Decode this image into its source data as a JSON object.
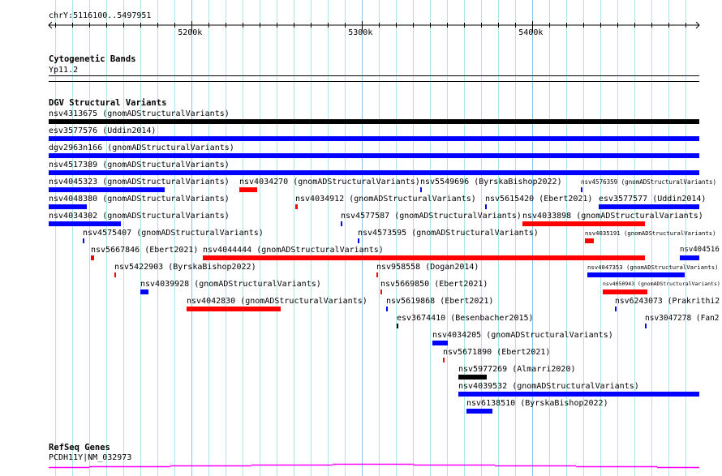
{
  "ruler": {
    "location": "chrY:5116100..5497951",
    "start": 5116100,
    "end": 5497951,
    "major_ticks": [
      "5200k",
      "5300k",
      "5400k"
    ],
    "major_values": [
      5200000,
      5300000,
      5400000
    ]
  },
  "cytoband": {
    "title": "Cytogenetic Bands",
    "band": "Yp11.2"
  },
  "dgv": {
    "title": "DGV Structural Variants",
    "colors": {
      "blue": "#0000ff",
      "red": "#ff0000",
      "black": "#000000"
    },
    "features": [
      {
        "row": 0,
        "label": "nsv4313675 (gnomADStructuralVariants)",
        "start": 5116100,
        "end": 5497951,
        "color": "black"
      },
      {
        "row": 1,
        "label": "esv3577576 (Uddin2014)",
        "start": 5116100,
        "end": 5497951,
        "color": "blue"
      },
      {
        "row": 2,
        "label": "dgv2963n166 (gnomADStructuralVariants)",
        "start": 5116100,
        "end": 5497951,
        "color": "blue"
      },
      {
        "row": 3,
        "label": "nsv4517389 (gnomADStructuralVariants)",
        "start": 5116100,
        "end": 5497951,
        "color": "blue"
      },
      {
        "row": 4,
        "label": "nsv4045323 (gnomADStructuralVariants)",
        "start": 5116100,
        "end": 5184195,
        "color": "blue"
      },
      {
        "row": 4,
        "label": "nsv4034270 (gnomADStructuralVariants)",
        "start": 5228005,
        "end": 5238481,
        "color": "red"
      },
      {
        "row": 4,
        "label": "nsv5549696 (ByrskaBishop2022)",
        "start": 5334195,
        "end": 5335147,
        "color": "blue"
      },
      {
        "row": 4,
        "label": "nsv4576359 (gnomADStructuralVariants)",
        "start": 5428481,
        "end": 5429433,
        "color": "blue"
      },
      {
        "row": 5,
        "label": "nsv4048380 (gnomADStructuralVariants)",
        "start": 5116100,
        "end": 5138481,
        "color": "blue"
      },
      {
        "row": 5,
        "label": "nsv4034912 (gnomADStructuralVariants)",
        "start": 5260862,
        "end": 5262290,
        "color": "red"
      },
      {
        "row": 5,
        "label": "nsv5615420 (Ebert2021)",
        "start": 5372290,
        "end": 5373243,
        "color": "blue"
      },
      {
        "row": 5,
        "label": "esv3577577 (Uddin2014)",
        "start": 5438957,
        "end": 5497951,
        "color": "blue"
      },
      {
        "row": 6,
        "label": "nsv4034302 (gnomADStructuralVariants)",
        "start": 5116100,
        "end": 5158481,
        "color": "blue"
      },
      {
        "row": 6,
        "label": "nsv4577587 (gnomADStructuralVariants)",
        "start": 5287529,
        "end": 5288481,
        "color": "blue"
      },
      {
        "row": 6,
        "label": "nsv4033898 (gnomADStructuralVariants)",
        "start": 5394195,
        "end": 5466100,
        "color": "red"
      },
      {
        "row": 7,
        "label": "nsv4575407 (gnomADStructuralVariants)",
        "start": 5136100,
        "end": 5137052,
        "color": "blue"
      },
      {
        "row": 7,
        "label": "nsv4573595 (gnomADStructuralVariants)",
        "start": 5297529,
        "end": 5298481,
        "color": "blue"
      },
      {
        "row": 7,
        "label": "nsv4035191 (gnomADStructuralVariants)",
        "start": 5430862,
        "end": 5436100,
        "color": "red"
      },
      {
        "row": 8,
        "label": "nsv5667846 (Ebert2021)",
        "start": 5140862,
        "end": 5142767,
        "color": "red"
      },
      {
        "row": 8,
        "label": "nsv4044444 (gnomADStructuralVariants)",
        "start": 5206576,
        "end": 5466100,
        "color": "red"
      },
      {
        "row": 8,
        "label": "nsv404516",
        "start": 5486576,
        "end": 5497951,
        "color": "blue"
      },
      {
        "row": 9,
        "label": "nsv5422903 (ByrskaBishop2022)",
        "start": 5154671,
        "end": 5155624,
        "color": "red"
      },
      {
        "row": 9,
        "label": "nsv958558 (Dogan2014)",
        "start": 5308481,
        "end": 5309433,
        "color": "red"
      },
      {
        "row": 9,
        "label": "nsv4047353 (gnomADStructuralVariants)",
        "start": 5432290,
        "end": 5489433,
        "color": "blue"
      },
      {
        "row": 10,
        "label": "nsv4039928 (gnomADStructuralVariants)",
        "start": 5169910,
        "end": 5174671,
        "color": "blue"
      },
      {
        "row": 10,
        "label": "nsv5669850 (Ebert2021)",
        "start": 5310862,
        "end": 5311814,
        "color": "red"
      },
      {
        "row": 10,
        "label": "nsv4050943 (gnomADStructuralVariants)",
        "start": 5441338,
        "end": 5467529,
        "color": "red"
      },
      {
        "row": 11,
        "label": "nsv4042830 (gnomADStructuralVariants)",
        "start": 5197052,
        "end": 5252290,
        "color": "red"
      },
      {
        "row": 11,
        "label": "nsv5619868 (Ebert2021)",
        "start": 5314195,
        "end": 5315147,
        "color": "blue"
      },
      {
        "row": 11,
        "label": "nsv6243073 (Prakrithi2",
        "start": 5448481,
        "end": 5449433,
        "color": "blue"
      },
      {
        "row": 12,
        "label": "esv3674410 (Besenbacher2015)",
        "start": 5320386,
        "end": 5321338,
        "color": "black"
      },
      {
        "row": 12,
        "label": "nsv3047278 (Fan2",
        "start": 5466100,
        "end": 5467052,
        "color": "blue"
      },
      {
        "row": 13,
        "label": "nsv4034205 (gnomADStructuralVariants)",
        "start": 5341338,
        "end": 5350386,
        "color": "blue"
      },
      {
        "row": 14,
        "label": "nsv5671890 (Ebert2021)",
        "start": 5347529,
        "end": 5348481,
        "color": "red"
      },
      {
        "row": 15,
        "label": "nsv5977269 (Almarri2020)",
        "start": 5356576,
        "end": 5373243,
        "color": "black"
      },
      {
        "row": 16,
        "label": "nsv4039532 (gnomADStructuralVariants)",
        "start": 5356576,
        "end": 5497951,
        "color": "blue"
      },
      {
        "row": 17,
        "label": "nsv6138510 (ByrskaBishop2022)",
        "start": 5361338,
        "end": 5376576,
        "color": "blue"
      }
    ]
  },
  "refseq": {
    "title": "RefSeq Genes",
    "gene": "PCDH11Y|NM_032973",
    "color": "#ff00ff"
  }
}
